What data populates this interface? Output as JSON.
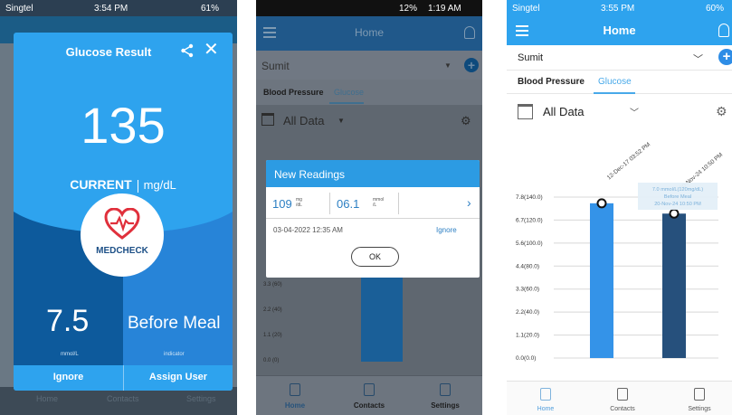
{
  "panel1": {
    "status": {
      "carrier": "Singtel",
      "time": "3:54 PM",
      "battery": "61%"
    },
    "bg_tabs": [
      "Home",
      "Contacts",
      "Settings"
    ],
    "dialog": {
      "title": "Glucose Result",
      "value": "135",
      "current_label": "CURRENT",
      "unit": "mg/dL",
      "brand": "MEDCHECK",
      "mmol_value": "7.5",
      "mmol_unit": "mmol/L",
      "meal_value": "Before Meal",
      "meal_caption": "indicator",
      "ignore_label": "Ignore",
      "assign_label": "Assign User"
    },
    "colors": {
      "dialog": "#2ea3ee",
      "left_panel": "#0d5a9c",
      "right_panel": "#2784d8"
    }
  },
  "panel2": {
    "status": {
      "battery": "12%",
      "time": "1:19 AM"
    },
    "header_title": "Home",
    "user": "Sumit",
    "tabs": [
      "Blood Pressure",
      "Glucose"
    ],
    "filter": "All Data",
    "y_ticks": [
      "3.3 (60)",
      "2.2 (40)",
      "1.1 (20)",
      "0.0 (0)"
    ],
    "nav": [
      "Home",
      "Contacts",
      "Settings"
    ],
    "dialog": {
      "title": "New Readings",
      "value1": "109",
      "unit1_top": "mg",
      "unit1_bottom": "/dL",
      "value2": "06.1",
      "unit2_top": "mmol",
      "unit2_bottom": "/L",
      "date": "03-04-2022 12:35 AM",
      "ignore_label": "Ignore",
      "ok_label": "OK"
    }
  },
  "panel3": {
    "status": {
      "carrier": "Singtel",
      "time": "3:55 PM",
      "battery": "60%"
    },
    "header_title": "Home",
    "user": "Sumit",
    "tabs": [
      "Blood Pressure",
      "Glucose"
    ],
    "filter": "All Data",
    "nav": [
      "Home",
      "Contacts",
      "Settings"
    ],
    "tooltip": [
      "7.0 mmol/L(120mg/dL)",
      "Before Meal",
      "20-Nov-24 10:50 PM"
    ]
  },
  "chart_data": {
    "type": "bar",
    "categories": [
      "12-Dec-17 03:52 PM",
      "20-Nov-24 10:50 PM"
    ],
    "series": [
      {
        "values": [
          7.5,
          7.0
        ],
        "colors": [
          "#3493e8",
          "#26507c"
        ]
      }
    ],
    "y_ticks": [
      "0.0(0.0)",
      "1.1(20.0)",
      "2.2(40.0)",
      "3.3(60.0)",
      "4.4(80.0)",
      "5.6(100.0)",
      "6.7(120.0)",
      "7.8(140.0)"
    ],
    "ylim": [
      0,
      7.8
    ],
    "grid": true
  }
}
